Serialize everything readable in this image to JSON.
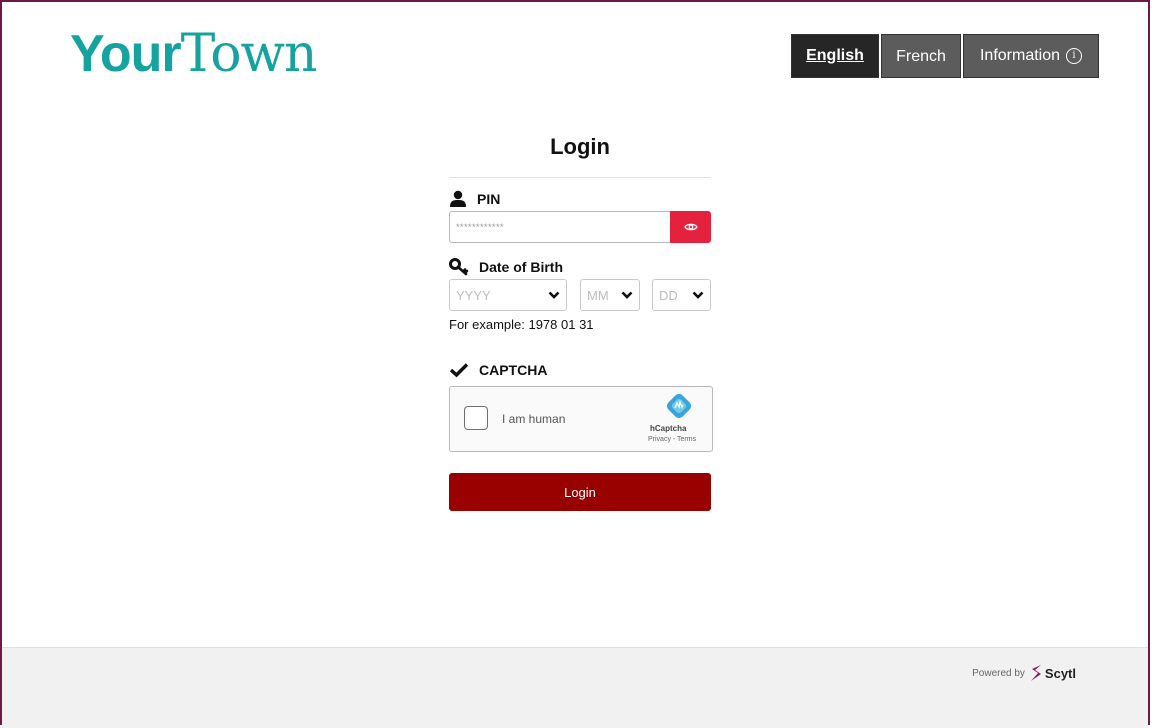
{
  "header": {
    "logo_part1": "Your",
    "logo_part2": "Town",
    "lang_english": "English",
    "lang_french": "French",
    "information": "Information",
    "info_glyph": "i"
  },
  "login": {
    "title": "Login",
    "pin_label": "PIN",
    "pin_placeholder": "************",
    "dob_label": "Date of Birth",
    "year_placeholder": "YYYY",
    "month_placeholder": "MM",
    "day_placeholder": "DD",
    "example": "For example: 1978 01 31",
    "captcha_label": "CAPTCHA",
    "captcha_text": "I am human",
    "hcaptcha_name": "hCaptcha",
    "hcaptcha_links": "Privacy - Terms",
    "submit": "Login"
  },
  "footer": {
    "powered_by": "Powered by",
    "brand": "Scytl"
  },
  "colors": {
    "logo": "#14a39e",
    "frame": "#6b1b46",
    "eye_button": "#e4223e",
    "login_button": "#990000",
    "lang_active": "#262626",
    "lang_inactive": "#5c5c5c"
  },
  "icons": [
    "user-icon",
    "eye-icon",
    "key-icon",
    "chevron-down-icon",
    "checkmark-icon",
    "hcaptcha-logo-icon",
    "scytl-logo-icon",
    "info-icon"
  ]
}
